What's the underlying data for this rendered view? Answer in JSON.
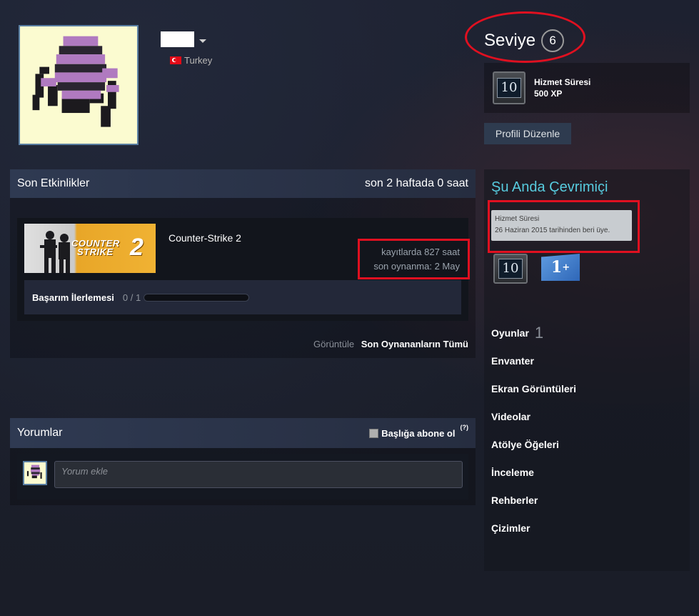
{
  "profile": {
    "country": "Turkey",
    "level_label": "Seviye",
    "level": "6"
  },
  "badge": {
    "icon_text": "10",
    "title": "Hizmet Süresi",
    "xp": "500 XP"
  },
  "edit_profile_label": "Profili Düzenle",
  "activity": {
    "title": "Son Etkinlikler",
    "summary": "son 2 haftada 0 saat",
    "game": {
      "capsule_logo_line1": "COUNTER",
      "capsule_logo_line2": "STRIKE",
      "capsule_logo_number": "2",
      "name": "Counter-Strike 2",
      "hours": "kayıtlarda 827 saat",
      "last_played": "son oynanma: 2 May",
      "achievement_label": "Başarım İlerlemesi",
      "achievement_count": "0 / 1",
      "achievement_progress": 0
    },
    "view_label": "Görüntüle",
    "view_all": "Son Oynananların Tümü"
  },
  "comments": {
    "title": "Yorumlar",
    "subscribe_label": "Başlığa abone ol",
    "help": "(?)",
    "placeholder": "Yorum ekle"
  },
  "sidebar": {
    "online_status": "Şu Anda Çevrimiçi",
    "tooltip_title": "Hizmet Süresi",
    "tooltip_text": "26 Haziran 2015 tarihinden beri üye.",
    "badge_years": "10",
    "badge_oneplus_main": "1",
    "badge_oneplus_sup": "+",
    "nav": [
      {
        "label": "Oyunlar",
        "count": "1"
      },
      {
        "label": "Envanter"
      },
      {
        "label": "Ekran Görüntüleri"
      },
      {
        "label": "Videolar"
      },
      {
        "label": "Atölye Öğeleri"
      },
      {
        "label": "İnceleme"
      },
      {
        "label": "Rehberler"
      },
      {
        "label": "Çizimler"
      }
    ]
  },
  "colors": {
    "annotation": "#e01020",
    "online": "#57cbde",
    "avatar_bg": "#fbfbd0",
    "avatar_purple": "#b07ac0"
  }
}
